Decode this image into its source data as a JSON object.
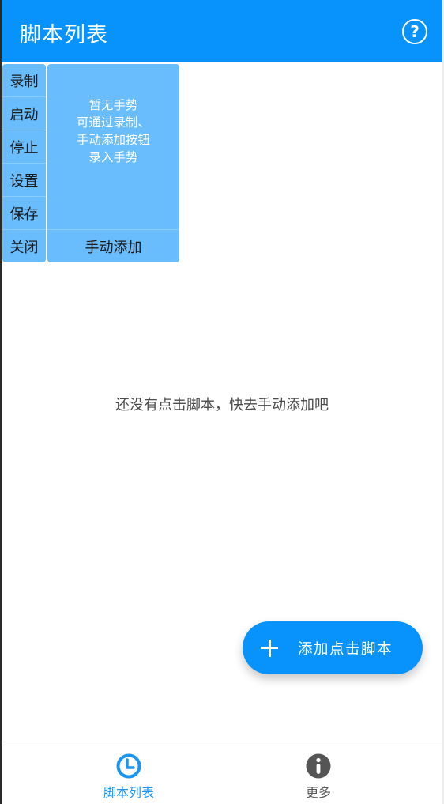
{
  "app_bar": {
    "title": "脚本列表",
    "help_icon": "help-circle-icon",
    "color": "#0793fb"
  },
  "side_menu": {
    "items": [
      {
        "label": "录制"
      },
      {
        "label": "启动"
      },
      {
        "label": "停止"
      },
      {
        "label": "设置"
      },
      {
        "label": "保存"
      },
      {
        "label": "关闭"
      }
    ]
  },
  "gesture_panel": {
    "empty_lines": [
      "暂无手势",
      "可通过录制、",
      "手动添加按钮",
      "录入手势"
    ],
    "add_button_label": "手动添加"
  },
  "main": {
    "empty_message": "还没有点击脚本，快去手动添加吧"
  },
  "fab": {
    "icon": "plus-icon",
    "label": "添加点击脚本"
  },
  "bottom_nav": {
    "items": [
      {
        "label": "脚本列表",
        "icon": "clock-icon",
        "active": true,
        "color": "#1a95f0"
      },
      {
        "label": "更多",
        "icon": "info-icon",
        "active": false,
        "color": "#555555"
      }
    ]
  }
}
